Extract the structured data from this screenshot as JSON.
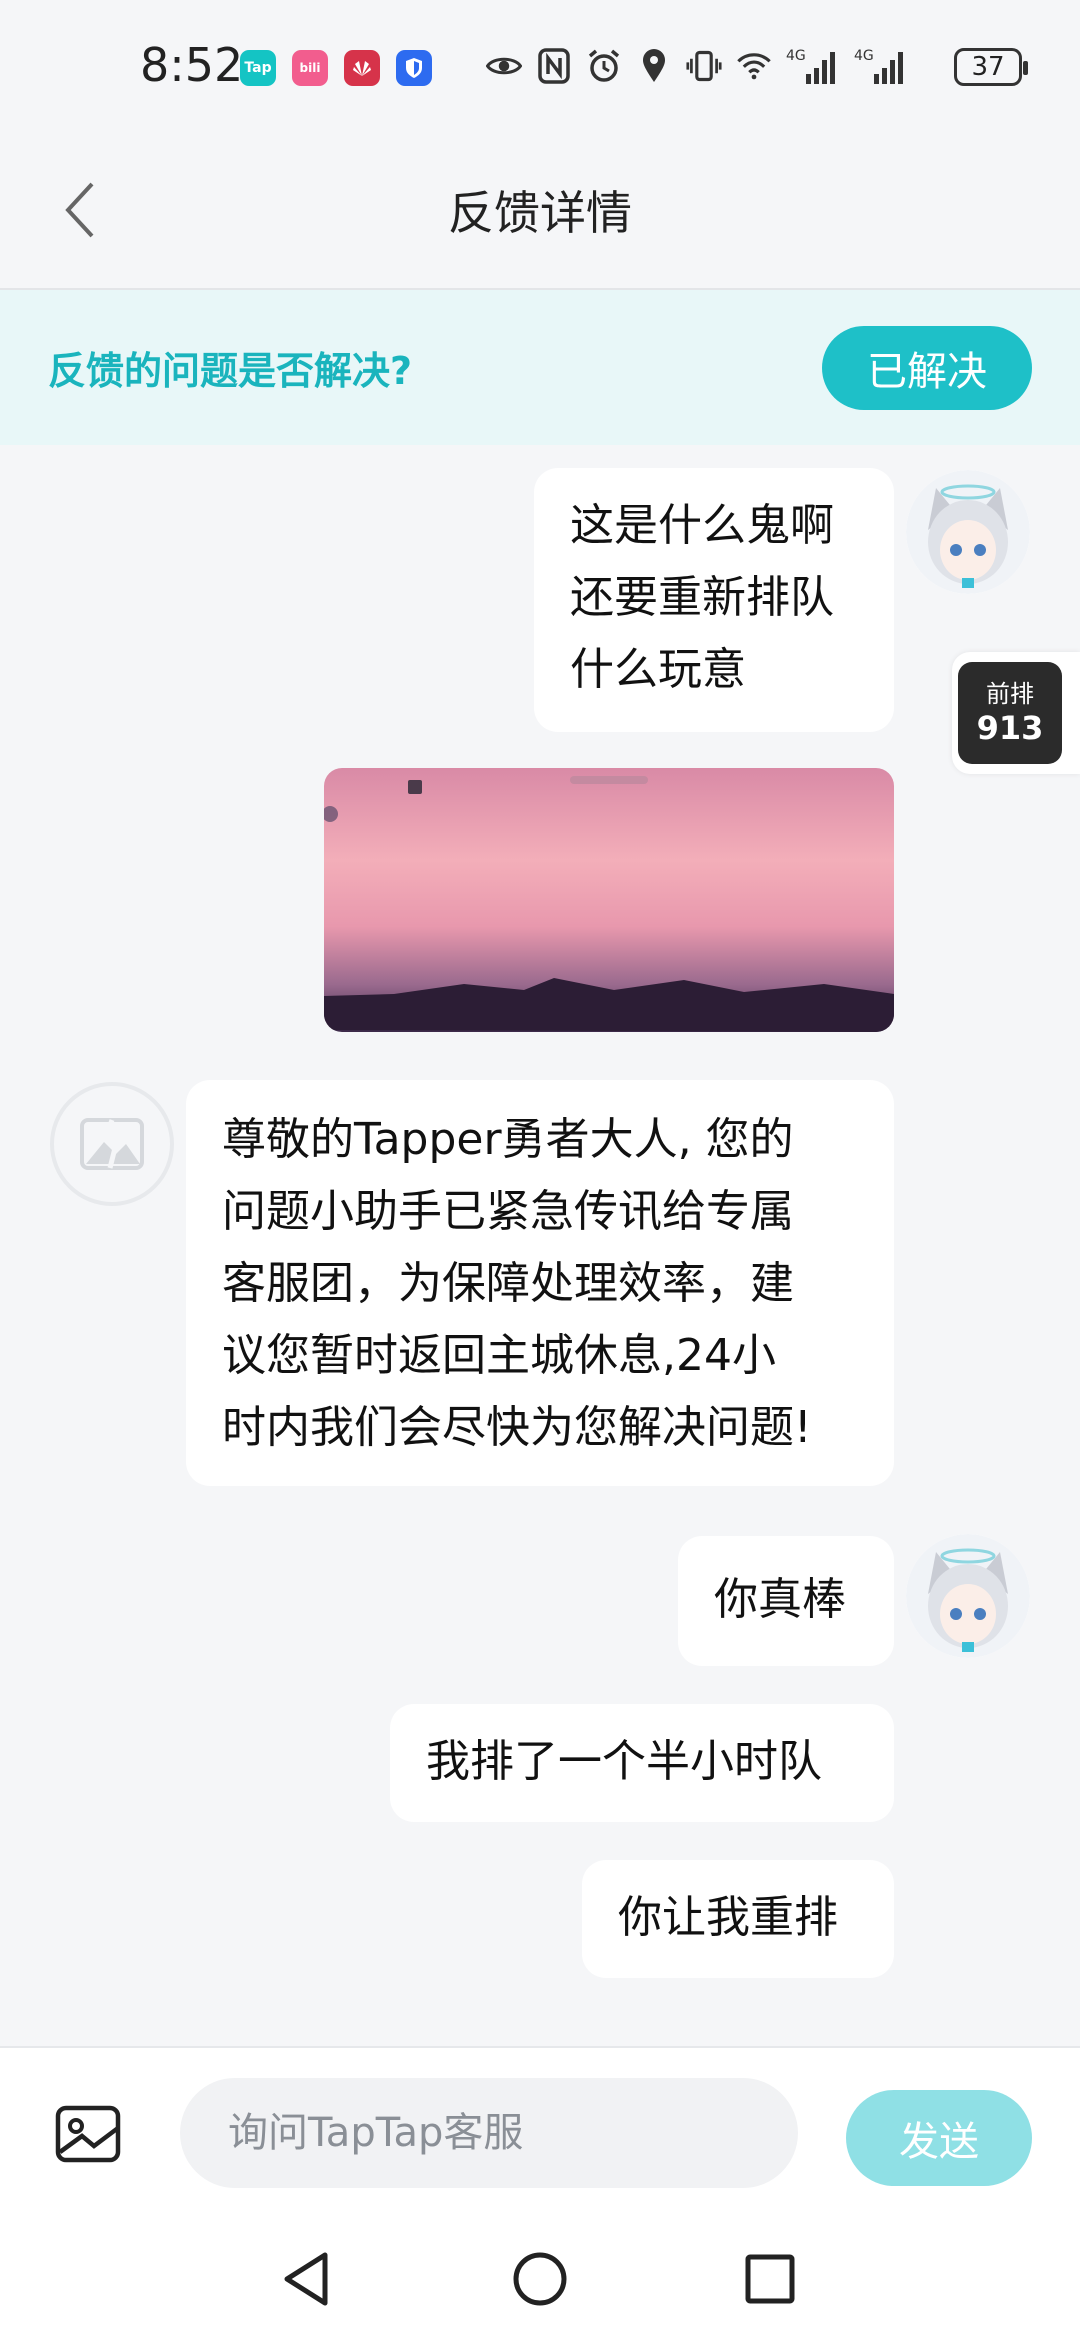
{
  "status_bar": {
    "time": "8:52",
    "notifications": [
      {
        "icon": "taptap-app-icon",
        "label": "Tap",
        "color": "#14c4c4"
      },
      {
        "icon": "bilibili-app-icon",
        "label": "bili",
        "color": "#f25d8e"
      },
      {
        "icon": "huawei-app-icon",
        "label": "",
        "color": "#d6334a"
      },
      {
        "icon": "security-shield-icon",
        "label": "",
        "color": "#2d6bf0"
      }
    ],
    "system_icons": [
      "eye-icon",
      "nfc-icon",
      "alarm-icon",
      "location-icon",
      "vibrate-icon",
      "wifi-icon",
      "signal-4g-icon",
      "signal-4g-icon"
    ],
    "network_labels": [
      "4G",
      "4G"
    ],
    "battery": "37"
  },
  "header": {
    "title": "反馈详情",
    "back_icon": "chevron-left-icon"
  },
  "banner": {
    "question": "反馈的问题是否解决?",
    "resolved_label": "已解决"
  },
  "queue": {
    "label": "前排",
    "count": "913"
  },
  "messages": {
    "m1": [
      "这是什么鬼啊",
      "还要重新排队",
      "什么玩意"
    ],
    "reply": [
      "尊敬的Tapper勇者大人, 您的",
      "问题小助手已紧急传讯给专属",
      "客服团，为保障处理效率，建",
      "议您暂时返回主城休息,24小",
      "时内我们会尽快为您解决问题!"
    ],
    "m2": "你真棒",
    "m3": "我排了一个半小时队",
    "m4": "你让我重排"
  },
  "input": {
    "placeholder": "询问TapTap客服",
    "value": "",
    "send_label": "发送",
    "image_icon": "image-icon"
  },
  "nav": [
    "back-triangle-icon",
    "home-circle-icon",
    "recents-square-icon"
  ]
}
